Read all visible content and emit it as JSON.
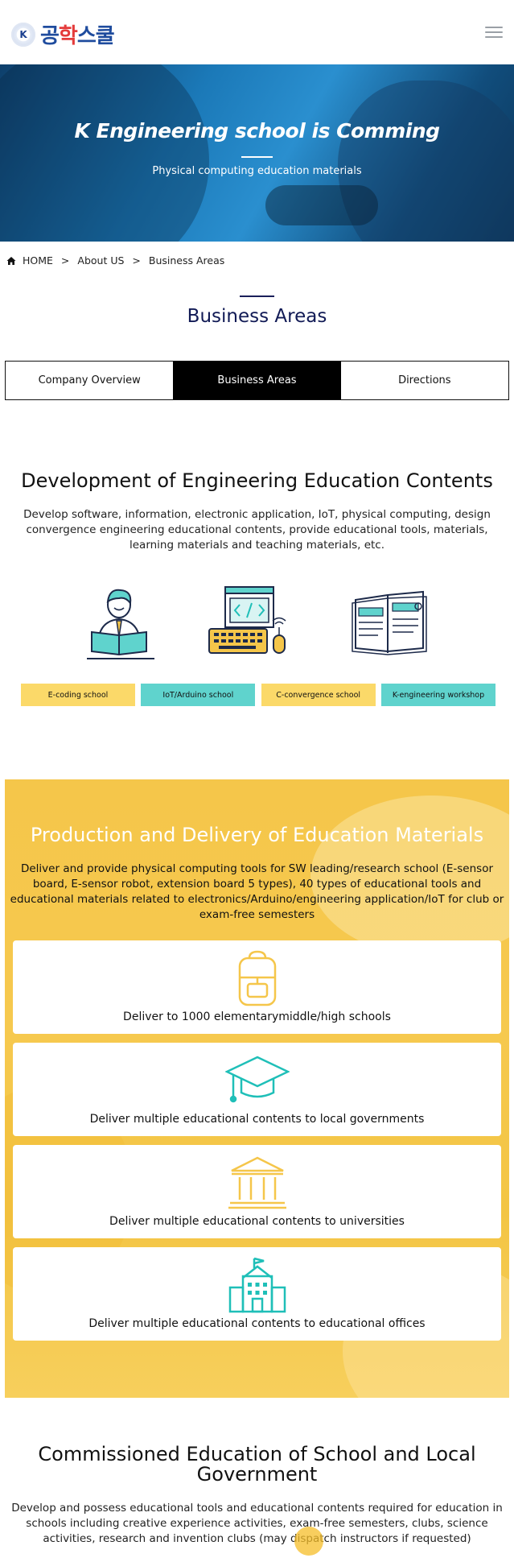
{
  "header": {
    "logo_mark": "K",
    "logo_text_a": "공",
    "logo_text_b": "학",
    "logo_text_c": "스쿨",
    "menu_icon": "hamburger-icon"
  },
  "hero": {
    "title": "K Engineering school is Comming",
    "subtitle": "Physical computing education materials"
  },
  "breadcrumb": {
    "home_icon": "home-icon",
    "items": [
      "HOME",
      "About US",
      "Business Areas"
    ],
    "separator": ">"
  },
  "page_title": "Business Areas",
  "tabs": [
    {
      "label": "Company Overview",
      "active": false
    },
    {
      "label": "Business Areas",
      "active": true
    },
    {
      "label": "Directions",
      "active": false
    }
  ],
  "development": {
    "title": "Development of Engineering Education Contents",
    "description": "Develop software, information, electronic application, IoT, physical computing, design convergence engineering educational contents, provide educational tools, materials, learning materials and teaching materials, etc.",
    "illustrations": [
      "student-reading-icon",
      "computer-keyboard-icon",
      "books-icon"
    ],
    "chips": [
      {
        "label": "E-coding school",
        "color": "#fbd969"
      },
      {
        "label": "IoT/Arduino school",
        "color": "#5fd3cd"
      },
      {
        "label": "C-convergence school",
        "color": "#fbd969"
      },
      {
        "label": "K-engineering workshop",
        "color": "#5fd3cd"
      }
    ]
  },
  "production": {
    "title": "Production and Delivery of Education Materials",
    "description": "Deliver and provide physical computing tools for SW leading/research school (E-sensor board, E-sensor robot, extension board 5 types), 40 types of educational tools and educational materials related to electronics/Arduino/engineering application/IoT for club or exam-free semesters",
    "cards": [
      {
        "icon": "backpack-icon",
        "label": "Deliver to 1000 elementarymiddle/high schools"
      },
      {
        "icon": "graduation-cap-icon",
        "label": "Deliver multiple educational contents to local governments"
      },
      {
        "icon": "university-building-icon",
        "label": "Deliver multiple educational contents to universities"
      },
      {
        "icon": "school-building-icon",
        "label": "Deliver multiple educational contents to educational offices"
      }
    ]
  },
  "commissioned": {
    "title": "Commissioned Education of School and Local Government",
    "description": "Develop and possess educational tools and educational contents required for education in schools including creative experience activities, exam-free semesters, clubs, science activities, research and invention clubs (may dispatch instructors if requested)"
  },
  "colors": {
    "accent_yellow": "#f5c64a",
    "accent_teal": "#1fbfb8",
    "navy": "#111a55"
  }
}
